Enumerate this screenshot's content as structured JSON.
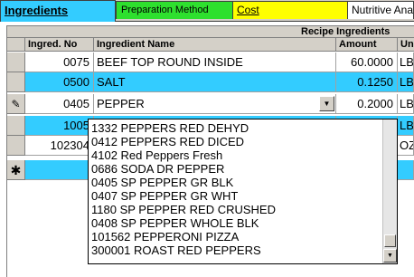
{
  "tabs": [
    {
      "label": "Ingredients",
      "active": true
    },
    {
      "label": "Preparation Method"
    },
    {
      "label": "Cost"
    },
    {
      "label": "Nutritive Analysis"
    }
  ],
  "grid": {
    "group_header": "Recipe Ingredients",
    "columns": [
      "Ingred. No",
      "Ingredient Name",
      "Amount",
      "Unit"
    ],
    "rows": [
      {
        "no": "0075",
        "name": "BEEF TOP ROUND INSIDE",
        "amount": "60.0000",
        "unit": "LB"
      },
      {
        "no": "0500",
        "name": "SALT",
        "amount": "0.1250",
        "unit": "LB"
      },
      {
        "no": "0405",
        "name": "PEPPER",
        "amount": "0.2000",
        "unit": "LB"
      },
      {
        "no": "1005",
        "name": "",
        "amount": "",
        "unit": "LB"
      },
      {
        "no": "102304",
        "name": "",
        "amount": "",
        "unit": "OZ"
      },
      {
        "no": "",
        "name": "",
        "amount": "",
        "unit": ""
      }
    ],
    "row_markers": {
      "edit": "✎",
      "new": "✱"
    },
    "combo_arrow": "▼"
  },
  "dropdown": {
    "options": [
      "1332 PEPPERS RED DEHYD",
      "0412 PEPPERS RED DICED",
      "4102 Red Peppers Fresh",
      "0686 SODA DR PEPPER",
      "0405 SP PEPPER GR BLK",
      "0407 SP PEPPER GR WHT",
      "1180 SP PEPPER RED CRUSHED",
      "0408 SP PEPPER WHOLE BLK",
      "101562 PEPPERONI PIZZA",
      "300001 ROAST RED PEPPERS"
    ],
    "scroll_down_arrow": "▼"
  },
  "colors": {
    "active_tab": "#33ccff",
    "prep_tab": "#2ee02e",
    "cost_tab": "#ffff00",
    "highlight_row": "#33ccff"
  }
}
